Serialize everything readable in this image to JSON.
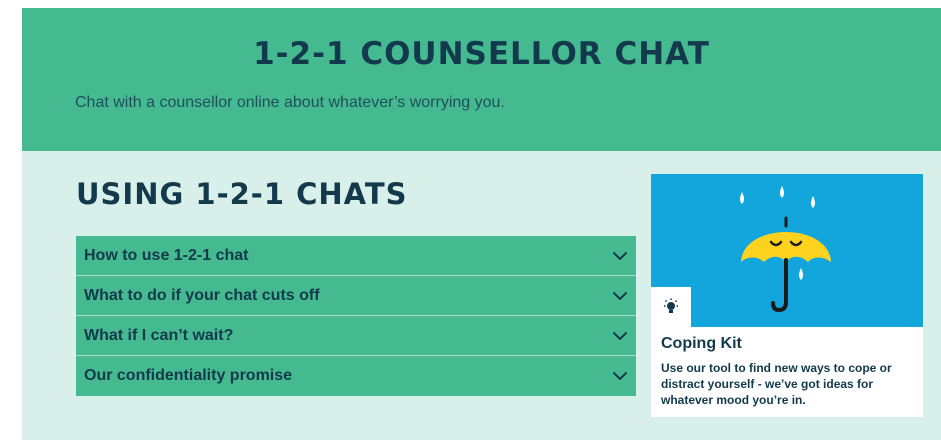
{
  "hero": {
    "title": "1-2-1 COUNSELLOR CHAT",
    "subtitle": "Chat with a counsellor online about whatever’s worrying you."
  },
  "section": {
    "title": "USING 1-2-1 CHATS"
  },
  "accordion": {
    "items": [
      {
        "label": "How to use 1-2-1 chat",
        "icon": "chevron-down-icon"
      },
      {
        "label": "What to do if your chat cuts off",
        "icon": "chevron-down-icon"
      },
      {
        "label": "What if I can’t wait?",
        "icon": "chevron-down-icon"
      },
      {
        "label": "Our confidentiality promise",
        "icon": "chevron-down-icon"
      }
    ]
  },
  "card": {
    "title": "Coping Kit",
    "description": "Use our tool to find new ways to cope or distract yourself - we’ve got ideas for whatever mood you’re in.",
    "image_icon": "umbrella-icon",
    "badge_icon": "lightbulb-icon"
  },
  "colors": {
    "accent": "#45b98f",
    "background": "#d9f0ea",
    "text": "#123a4c",
    "card_image": "#13a6dc",
    "umbrella": "#ffd21f"
  }
}
